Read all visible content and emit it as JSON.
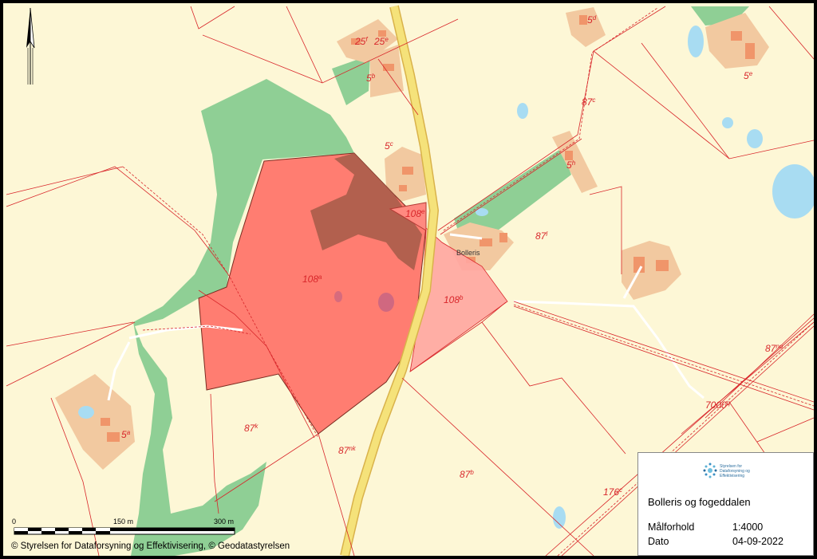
{
  "map": {
    "title": "Bolleris og fogeddalen",
    "scale_label": "Målforhold",
    "scale_value": "1:4000",
    "date_label": "Dato",
    "date_value": "04-09-2022",
    "place_name": "Bolleris",
    "copyright": "© Styrelsen for Dataforsyning og Effektivisering, © Geodatastyrelsen",
    "logo_text": [
      "Styrelsen for",
      "Dataforsyning og",
      "Effektivisering"
    ],
    "scalebar": {
      "start": "0",
      "mid": "150 m",
      "end": "300 m"
    },
    "colors": {
      "background": "#fdf7d6",
      "forest": "#8fcf95",
      "building_plot": "#f2c9a0",
      "building": "#f0956a",
      "selected_area": "#ff6f66",
      "selected_dark": "#a45a48",
      "water": "#a8dcf2",
      "road": "#f5e27a",
      "parcel_line": "#d8262a"
    },
    "parcels": [
      {
        "id": "25f",
        "num": "25",
        "sup": "f"
      },
      {
        "id": "25e",
        "num": "25",
        "sup": "e"
      },
      {
        "id": "5d",
        "num": "5",
        "sup": "d"
      },
      {
        "id": "5b",
        "num": "5",
        "sup": "b"
      },
      {
        "id": "5e",
        "num": "5",
        "sup": "e"
      },
      {
        "id": "87c",
        "num": "87",
        "sup": "c"
      },
      {
        "id": "5c",
        "num": "5",
        "sup": "c"
      },
      {
        "id": "5h",
        "num": "5",
        "sup": "h"
      },
      {
        "id": "108e",
        "num": "108",
        "sup": "e"
      },
      {
        "id": "87l",
        "num": "87",
        "sup": "l"
      },
      {
        "id": "108a",
        "num": "108",
        "sup": "a"
      },
      {
        "id": "108b",
        "num": "108",
        "sup": "b"
      },
      {
        "id": "87no",
        "num": "87",
        "sup": "no"
      },
      {
        "id": "7000q",
        "num": "7000",
        "sup": "q"
      },
      {
        "id": "5a",
        "num": "5",
        "sup": "a"
      },
      {
        "id": "87k",
        "num": "87",
        "sup": "k"
      },
      {
        "id": "87nk",
        "num": "87",
        "sup": "nk"
      },
      {
        "id": "87b",
        "num": "87",
        "sup": "b"
      },
      {
        "id": "176c",
        "num": "176",
        "sup": "c"
      }
    ]
  }
}
